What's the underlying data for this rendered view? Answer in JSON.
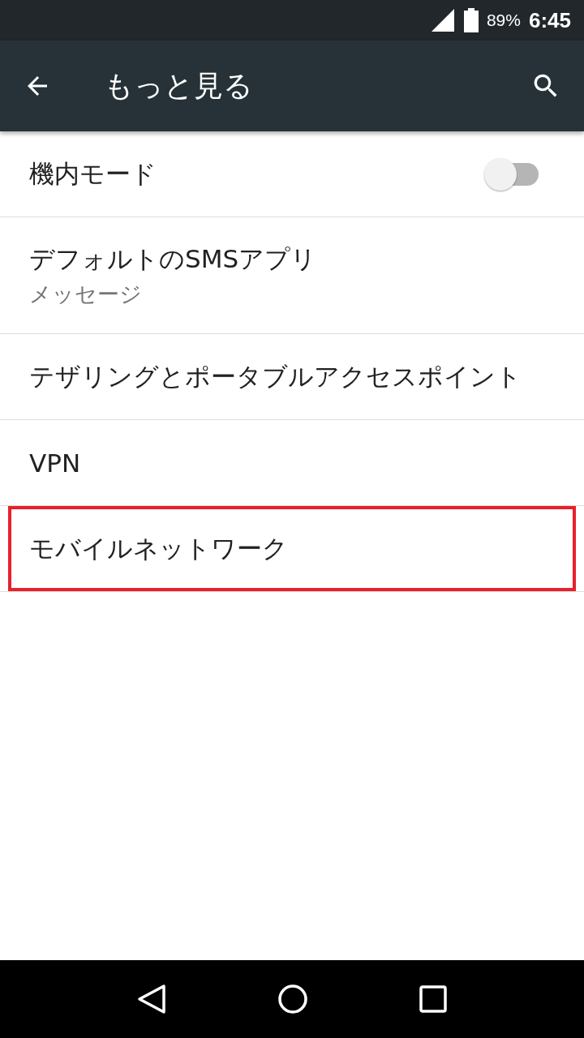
{
  "status_bar": {
    "battery": "89%",
    "time": "6:45"
  },
  "app_bar": {
    "title": "もっと見る"
  },
  "items": [
    {
      "kind": "switch",
      "title": "機内モード",
      "on": false,
      "highlighted": false
    },
    {
      "kind": "plain",
      "title": "デフォルトのSMSアプリ",
      "summary": "メッセージ",
      "highlighted": false
    },
    {
      "kind": "plain",
      "title": "テザリングとポータブルアクセスポイント",
      "highlighted": false
    },
    {
      "kind": "plain",
      "title": "VPN",
      "highlighted": false
    },
    {
      "kind": "plain",
      "title": "モバイルネットワーク",
      "highlighted": true
    }
  ]
}
